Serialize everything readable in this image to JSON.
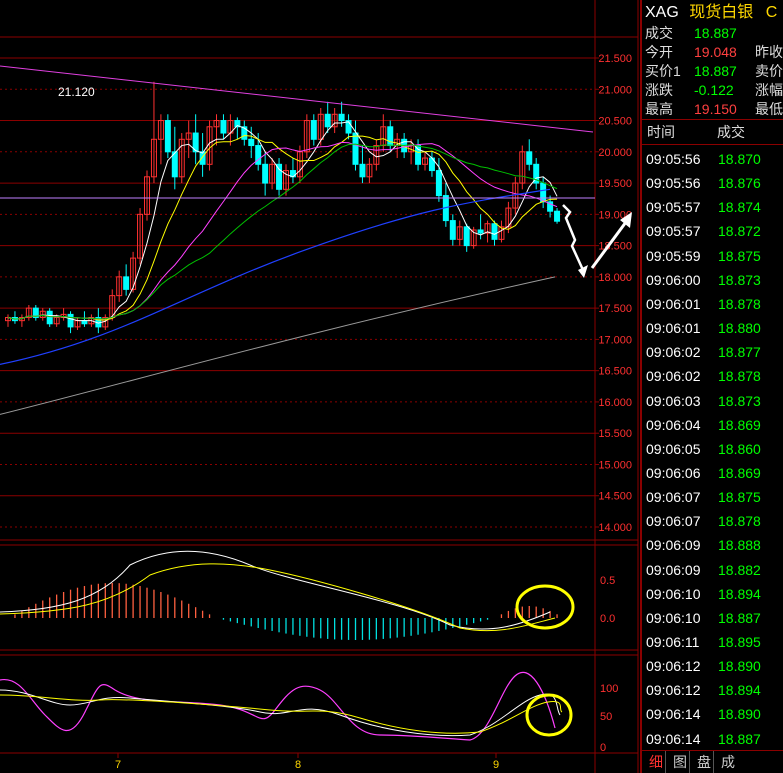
{
  "header": {
    "code": "XAG",
    "name": "现货白银",
    "extra": "C"
  },
  "quote": {
    "rows": [
      {
        "label": "成交",
        "value": "18.887",
        "color": "g",
        "label2": ""
      },
      {
        "label": "今开",
        "value": "19.048",
        "color": "r",
        "label2": "昨收"
      },
      {
        "label": "买价1",
        "value": "18.887",
        "color": "g",
        "label2": "卖价"
      },
      {
        "label": "涨跌",
        "value": "-0.122",
        "color": "g",
        "label2": "涨幅"
      },
      {
        "label": "最高",
        "value": "19.150",
        "color": "r",
        "label2": "最低"
      }
    ]
  },
  "ticks_header": {
    "time": "时间",
    "price": "成交"
  },
  "ticks": [
    {
      "time": "09:05:56",
      "price": "18.870"
    },
    {
      "time": "09:05:56",
      "price": "18.876"
    },
    {
      "time": "09:05:57",
      "price": "18.874"
    },
    {
      "time": "09:05:57",
      "price": "18.872"
    },
    {
      "time": "09:05:59",
      "price": "18.875"
    },
    {
      "time": "09:06:00",
      "price": "18.873"
    },
    {
      "time": "09:06:01",
      "price": "18.878"
    },
    {
      "time": "09:06:01",
      "price": "18.880"
    },
    {
      "time": "09:06:02",
      "price": "18.877"
    },
    {
      "time": "09:06:02",
      "price": "18.878"
    },
    {
      "time": "09:06:03",
      "price": "18.873"
    },
    {
      "time": "09:06:04",
      "price": "18.869"
    },
    {
      "time": "09:06:05",
      "price": "18.860"
    },
    {
      "time": "09:06:06",
      "price": "18.869"
    },
    {
      "time": "09:06:07",
      "price": "18.875"
    },
    {
      "time": "09:06:07",
      "price": "18.878"
    },
    {
      "time": "09:06:09",
      "price": "18.888"
    },
    {
      "time": "09:06:09",
      "price": "18.882"
    },
    {
      "time": "09:06:10",
      "price": "18.894"
    },
    {
      "time": "09:06:10",
      "price": "18.887"
    },
    {
      "time": "09:06:11",
      "price": "18.895"
    },
    {
      "time": "09:06:12",
      "price": "18.890"
    },
    {
      "time": "09:06:12",
      "price": "18.894"
    },
    {
      "time": "09:06:14",
      "price": "18.890"
    },
    {
      "time": "09:06:14",
      "price": "18.887"
    }
  ],
  "tabs": [
    "细",
    "图",
    "盘",
    "成"
  ],
  "chart": {
    "price_axis": [
      "21.500",
      "21.000",
      "20.500",
      "20.000",
      "19.500",
      "19.000",
      "18.500",
      "18.000",
      "17.500",
      "17.000",
      "16.500",
      "16.000",
      "15.500",
      "15.000",
      "14.500",
      "14.000"
    ],
    "high_label": "21.120",
    "macd_axis": [
      "0.5",
      "0.0"
    ],
    "kdj_axis": [
      "100",
      "50",
      "0"
    ],
    "date_labels": [
      "7",
      "8",
      "9"
    ],
    "colors": {
      "up": "#ff3030",
      "down": "#00ffff",
      "grid": "#8b0000"
    }
  },
  "chart_data": {
    "type": "candlestick",
    "ylim": [
      14.0,
      21.5
    ],
    "candles": [
      [
        17.3,
        17.4,
        17.2,
        17.35
      ],
      [
        17.35,
        17.45,
        17.25,
        17.3
      ],
      [
        17.3,
        17.4,
        17.2,
        17.35
      ],
      [
        17.35,
        17.55,
        17.3,
        17.5
      ],
      [
        17.5,
        17.55,
        17.3,
        17.35
      ],
      [
        17.35,
        17.5,
        17.3,
        17.45
      ],
      [
        17.45,
        17.5,
        17.2,
        17.25
      ],
      [
        17.25,
        17.4,
        17.2,
        17.35
      ],
      [
        17.35,
        17.5,
        17.3,
        17.4
      ],
      [
        17.4,
        17.45,
        17.1,
        17.2
      ],
      [
        17.2,
        17.35,
        17.15,
        17.3
      ],
      [
        17.3,
        17.45,
        17.2,
        17.25
      ],
      [
        17.25,
        17.4,
        17.2,
        17.35
      ],
      [
        17.35,
        17.5,
        17.1,
        17.2
      ],
      [
        17.2,
        17.4,
        17.15,
        17.35
      ],
      [
        17.35,
        17.8,
        17.3,
        17.7
      ],
      [
        17.7,
        18.1,
        17.6,
        18.0
      ],
      [
        18.0,
        18.2,
        17.7,
        17.8
      ],
      [
        17.8,
        18.4,
        17.75,
        18.3
      ],
      [
        18.3,
        19.1,
        18.2,
        19.0
      ],
      [
        19.0,
        19.7,
        18.9,
        19.6
      ],
      [
        19.6,
        21.12,
        19.5,
        20.2
      ],
      [
        20.2,
        20.6,
        19.8,
        20.5
      ],
      [
        20.5,
        20.6,
        19.9,
        20.0
      ],
      [
        20.0,
        20.4,
        19.4,
        19.6
      ],
      [
        19.6,
        20.3,
        19.5,
        20.2
      ],
      [
        20.2,
        20.5,
        19.9,
        20.3
      ],
      [
        20.3,
        20.6,
        19.8,
        20.0
      ],
      [
        20.0,
        20.3,
        19.6,
        19.8
      ],
      [
        19.8,
        20.5,
        19.7,
        20.4
      ],
      [
        20.4,
        20.6,
        20.1,
        20.5
      ],
      [
        20.5,
        20.6,
        20.2,
        20.3
      ],
      [
        20.3,
        20.6,
        20.1,
        20.5
      ],
      [
        20.5,
        20.55,
        20.2,
        20.4
      ],
      [
        20.4,
        20.5,
        20.1,
        20.2
      ],
      [
        20.2,
        20.4,
        19.9,
        20.1
      ],
      [
        20.1,
        20.3,
        19.7,
        19.8
      ],
      [
        19.8,
        20.0,
        19.3,
        19.5
      ],
      [
        19.5,
        19.9,
        19.4,
        19.8
      ],
      [
        19.8,
        19.9,
        19.3,
        19.4
      ],
      [
        19.4,
        19.8,
        19.3,
        19.7
      ],
      [
        19.7,
        19.9,
        19.5,
        19.6
      ],
      [
        19.6,
        20.1,
        19.5,
        20.0
      ],
      [
        20.0,
        20.6,
        19.9,
        20.5
      ],
      [
        20.5,
        20.6,
        20.1,
        20.2
      ],
      [
        20.2,
        20.7,
        20.1,
        20.6
      ],
      [
        20.6,
        20.8,
        20.3,
        20.4
      ],
      [
        20.4,
        20.7,
        20.3,
        20.6
      ],
      [
        20.6,
        20.8,
        20.4,
        20.5
      ],
      [
        20.5,
        20.6,
        20.2,
        20.3
      ],
      [
        20.3,
        20.5,
        19.7,
        19.8
      ],
      [
        19.8,
        20.1,
        19.5,
        19.6
      ],
      [
        19.6,
        19.9,
        19.5,
        19.8
      ],
      [
        19.8,
        20.2,
        19.7,
        20.1
      ],
      [
        20.1,
        20.6,
        20.0,
        20.4
      ],
      [
        20.4,
        20.5,
        20.0,
        20.1
      ],
      [
        20.1,
        20.3,
        19.9,
        20.2
      ],
      [
        20.2,
        20.3,
        19.9,
        20.0
      ],
      [
        20.0,
        20.2,
        19.8,
        20.1
      ],
      [
        20.1,
        20.2,
        19.7,
        19.8
      ],
      [
        19.8,
        20.0,
        19.7,
        19.9
      ],
      [
        19.9,
        20.0,
        19.6,
        19.7
      ],
      [
        19.7,
        19.9,
        19.2,
        19.3
      ],
      [
        19.3,
        19.5,
        18.8,
        18.9
      ],
      [
        18.9,
        19.0,
        18.5,
        18.6
      ],
      [
        18.6,
        18.9,
        18.5,
        18.8
      ],
      [
        18.8,
        18.85,
        18.4,
        18.5
      ],
      [
        18.5,
        18.8,
        18.45,
        18.75
      ],
      [
        18.75,
        19.0,
        18.6,
        18.7
      ],
      [
        18.7,
        18.9,
        18.55,
        18.85
      ],
      [
        18.85,
        18.9,
        18.5,
        18.6
      ],
      [
        18.6,
        18.9,
        18.55,
        18.8
      ],
      [
        18.8,
        19.2,
        18.7,
        19.1
      ],
      [
        19.1,
        19.6,
        19.0,
        19.5
      ],
      [
        19.5,
        20.1,
        19.4,
        20.0
      ],
      [
        20.0,
        20.2,
        19.7,
        19.8
      ],
      [
        19.8,
        19.9,
        19.4,
        19.5
      ],
      [
        19.5,
        19.6,
        19.1,
        19.2
      ],
      [
        19.2,
        19.3,
        18.95,
        19.05
      ],
      [
        19.05,
        19.1,
        18.85,
        18.89
      ]
    ]
  }
}
